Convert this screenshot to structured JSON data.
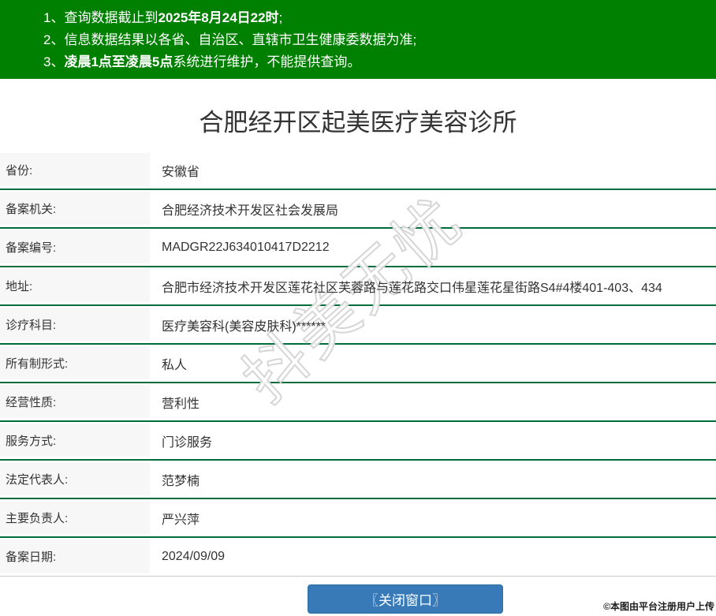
{
  "notice_bar": {
    "bg_color": "#008000",
    "items": [
      {
        "segments": [
          {
            "text": "1、查询数据截止到",
            "bold": false
          },
          {
            "text": "2025年8月24日22时",
            "bold": true
          },
          {
            "text": ";",
            "bold": false
          }
        ]
      },
      {
        "segments": [
          {
            "text": "2、信息数据结果以各省、自治区、直辖市卫生健康委数据为准;",
            "bold": false
          }
        ]
      },
      {
        "segments": [
          {
            "text": "3、",
            "bold": false
          },
          {
            "text": "凌晨1点至凌晨5点",
            "bold": true
          },
          {
            "text": "系统进行维护，不能提供查询。",
            "bold": false
          }
        ]
      }
    ]
  },
  "page_title": "合肥经开区起美医疗美容诊所",
  "record_table": {
    "border_color": "#006c3c",
    "label_bg": "#f7f7f7",
    "rows": [
      {
        "label": "省份:",
        "value": "安徽省"
      },
      {
        "label": "备案机关:",
        "value": "合肥经济技术开发区社会发展局"
      },
      {
        "label": "备案编号:",
        "value": "MADGR22J634010417D2212"
      },
      {
        "label": "地址:",
        "value": "合肥市经济技术开发区莲花社区芙蓉路与莲花路交口伟星莲花星街路S4#4楼401-403、434"
      },
      {
        "label": "诊疗科目:",
        "value": "医疗美容科(美容皮肤科)******"
      },
      {
        "label": "所有制形式:",
        "value": "私人"
      },
      {
        "label": "经营性质:",
        "value": "营利性"
      },
      {
        "label": "服务方式:",
        "value": "门诊服务"
      },
      {
        "label": "法定代表人:",
        "value": "范梦楠"
      },
      {
        "label": "主要负责人:",
        "value": "严兴萍"
      },
      {
        "label": "备案日期:",
        "value": "2024/09/09"
      }
    ]
  },
  "watermark": {
    "text": "抖美无忧"
  },
  "close_button": {
    "label": "〖关闭窗口〗",
    "bg_color": "#3879b8"
  },
  "footer_note": {
    "text": "©本图由平台注册用户上传"
  }
}
